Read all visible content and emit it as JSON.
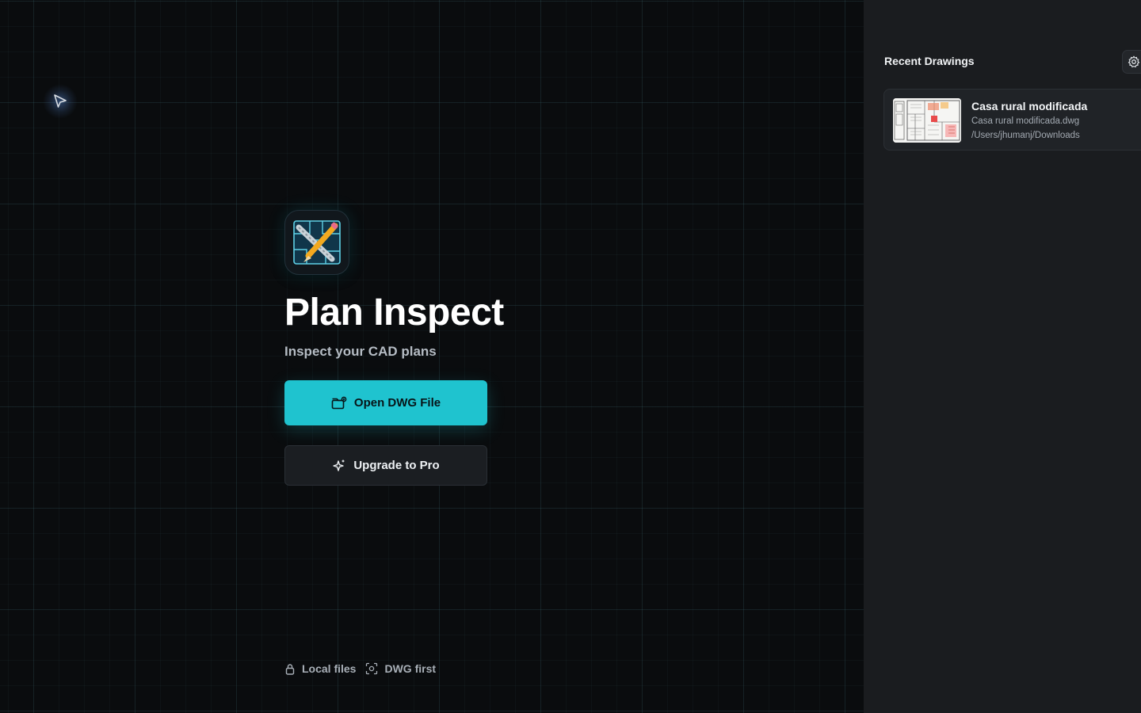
{
  "app": {
    "title": "Plan Inspect",
    "subtitle": "Inspect your CAD plans",
    "accent_color": "#1fc3cf"
  },
  "actions": {
    "open_label": "Open DWG File",
    "open_icon": "folder-open-icon",
    "upgrade_label": "Upgrade to Pro",
    "upgrade_icon": "sparkle-icon"
  },
  "footer": {
    "tags": [
      {
        "icon": "lock-icon",
        "label": "Local files"
      },
      {
        "icon": "scan-icon",
        "label": "DWG first"
      }
    ]
  },
  "sidebar": {
    "title": "Recent Drawings",
    "settings_icon": "gear-icon",
    "recent": [
      {
        "title": "Casa rural modificada",
        "filename": "Casa rural modificada.dwg",
        "path": "/Users/jhumanj/Downloads"
      }
    ]
  }
}
